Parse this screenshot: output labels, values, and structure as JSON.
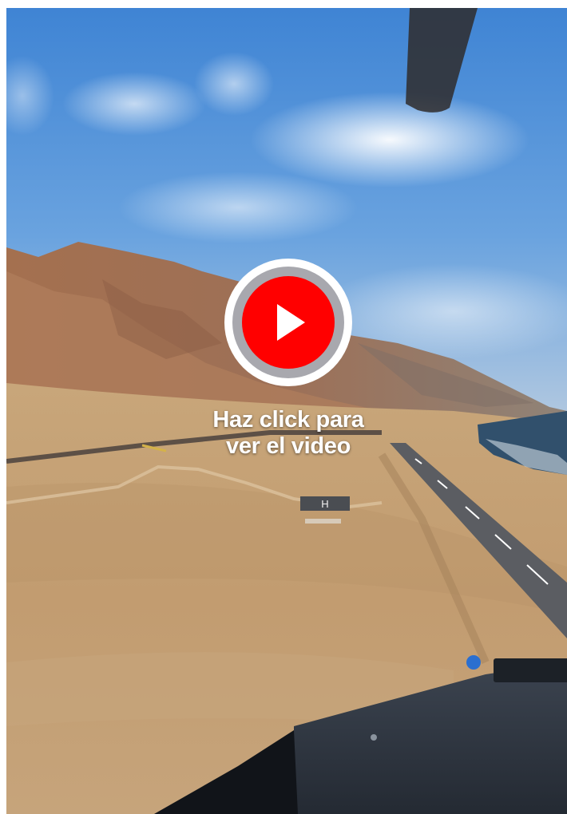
{
  "video": {
    "cta_line1": "Haz click para",
    "cta_line2": "ver el video",
    "play_icon": "youtube-play-icon",
    "accent_color": "#ff0000"
  },
  "heliport": {
    "marking": "H"
  }
}
